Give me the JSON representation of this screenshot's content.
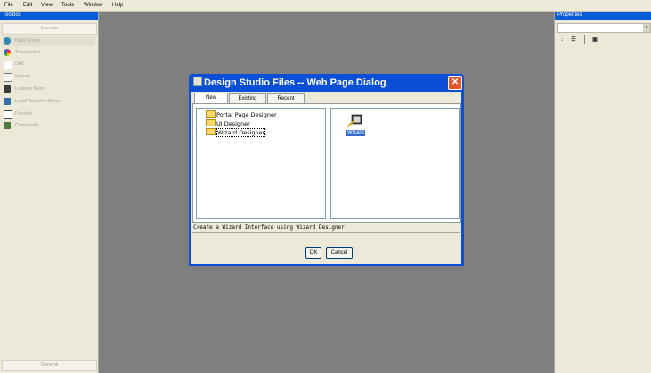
{
  "menu": {
    "items": [
      "File",
      "Edit",
      "View",
      "Tools",
      "Window",
      "Help"
    ]
  },
  "toolbox": {
    "title": "Toolbox",
    "section": "Lawson",
    "items": [
      {
        "label": "Data Query",
        "icon": "data-query-icon",
        "color": "#2e8bb6"
      },
      {
        "label": "Transaction",
        "icon": "transaction-icon",
        "color": "#d04ab0"
      },
      {
        "label": "Drill",
        "icon": "drill-icon",
        "color": "#555555"
      },
      {
        "label": "Report",
        "icon": "report-icon",
        "color": "#6b6b6b"
      },
      {
        "label": "Lawson Menu",
        "icon": "lawson-menu-icon",
        "color": "#3c3c3c"
      },
      {
        "label": "Local Transfer Menu",
        "icon": "local-transfer-menu-icon",
        "color": "#3470a8"
      },
      {
        "label": "Formlet",
        "icon": "formlet-icon",
        "color": "#444444"
      },
      {
        "label": "Composite",
        "icon": "composite-icon",
        "color": "#4c7a3c"
      }
    ],
    "footer": "General"
  },
  "properties": {
    "title": "Properties"
  },
  "dialog": {
    "title": "Design Studio Files -- Web Page Dialog",
    "tabs": [
      "New",
      "Existing",
      "Recent"
    ],
    "tree": [
      "Portal Page Designer",
      "UI Designer",
      "Wizard Designer"
    ],
    "list": [
      {
        "label": "Wizard",
        "icon": "wizard-icon"
      }
    ],
    "description": "Create a Wizard Interface using Wizard Designer.",
    "ok": "OK",
    "cancel": "Cancel"
  }
}
